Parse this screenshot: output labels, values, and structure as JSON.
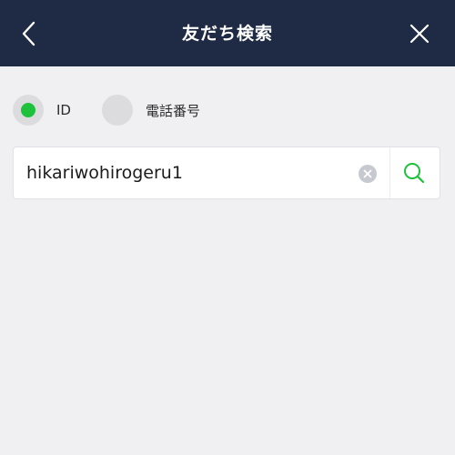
{
  "header": {
    "title": "友だち検索",
    "back_icon": "chevron-left-icon",
    "close_icon": "close-icon"
  },
  "search_type": {
    "selected": "id",
    "options": [
      {
        "id": "id",
        "label": "ID"
      },
      {
        "id": "phone",
        "label": "電話番号"
      }
    ]
  },
  "search": {
    "value": "hikariwohirogeru1",
    "clear_icon": "clear-icon",
    "search_icon": "search-icon"
  },
  "colors": {
    "header_bg": "#1f2a44",
    "background": "#f0f0f3",
    "accent": "#1dc13b",
    "radio_bg": "#dcdcdf"
  }
}
